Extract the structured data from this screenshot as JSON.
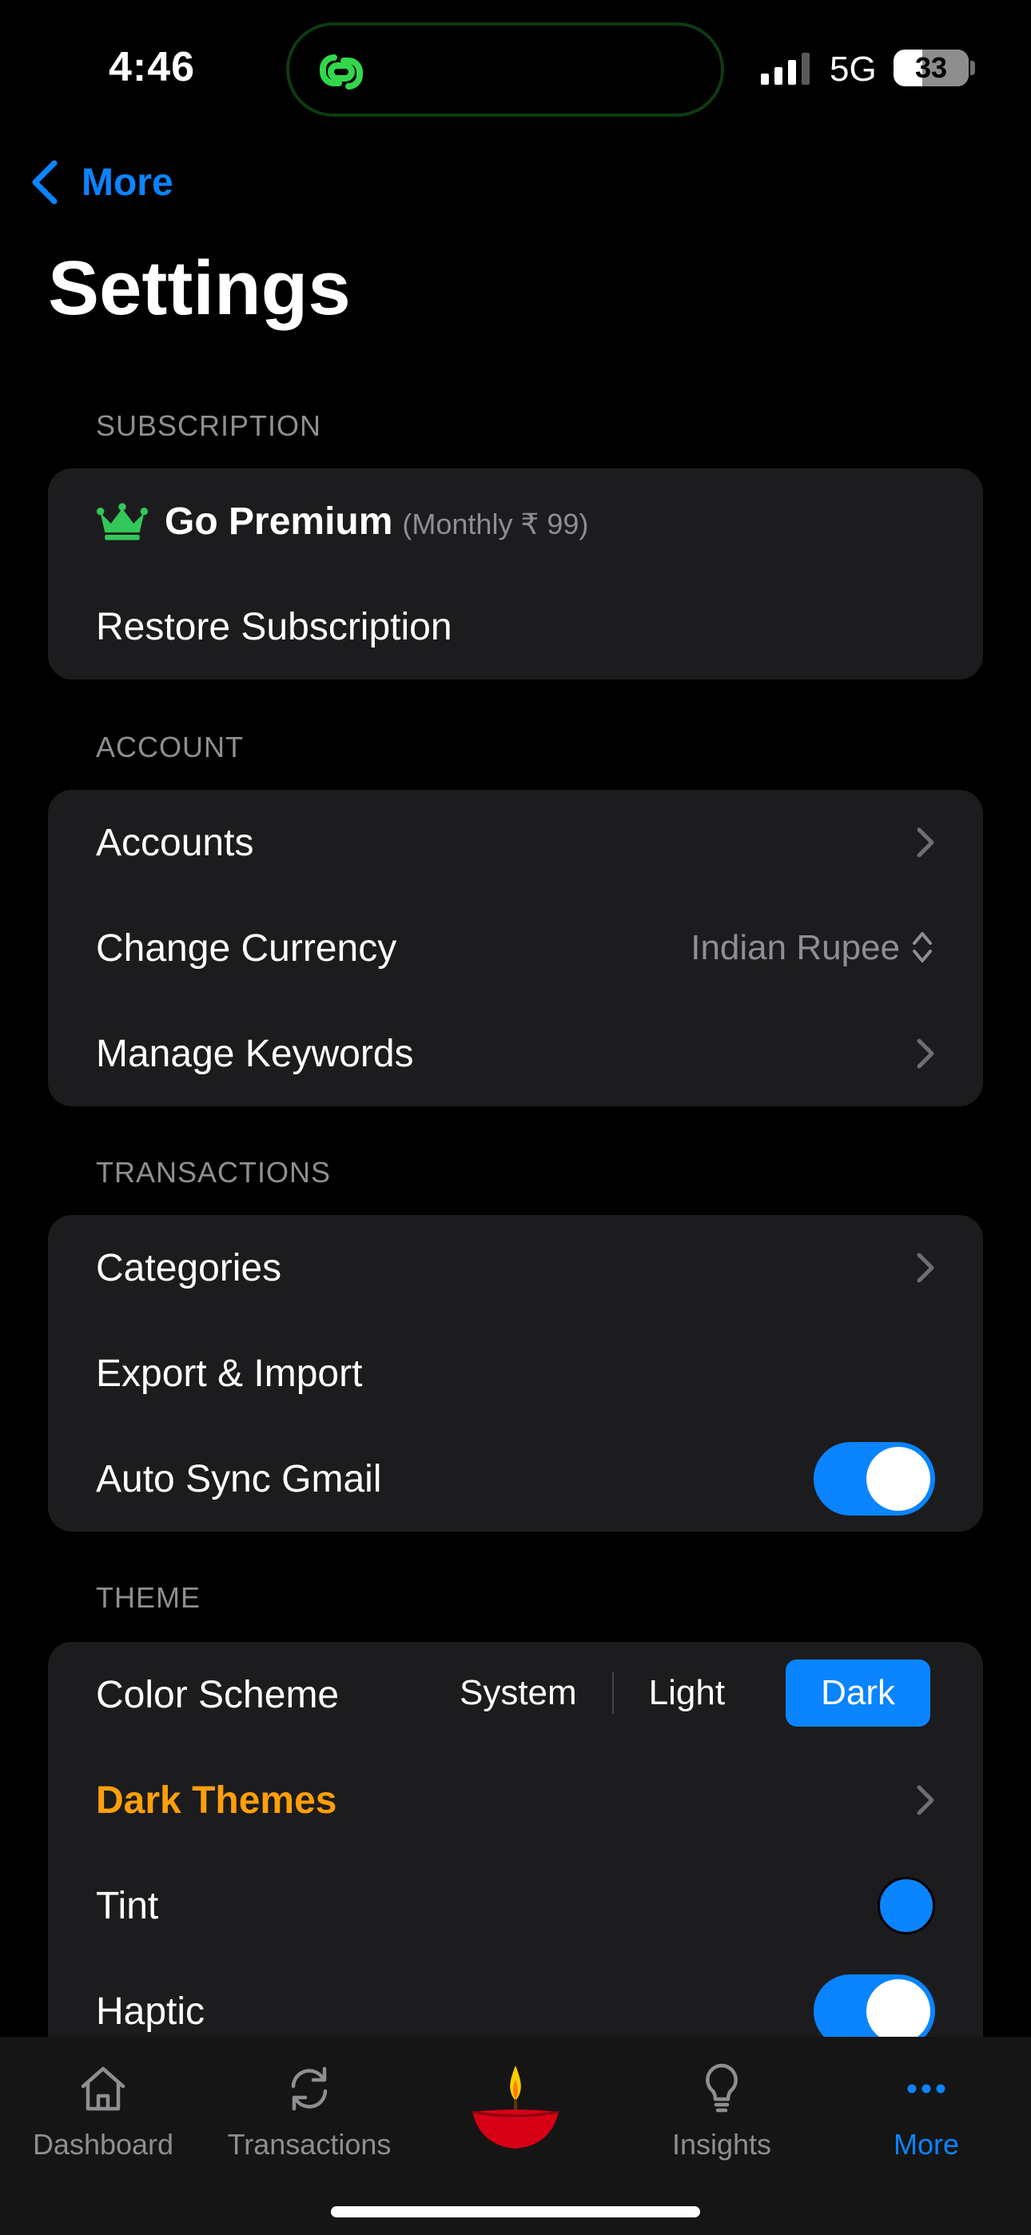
{
  "status_bar": {
    "time": "4:46",
    "network": "5G",
    "battery": "33"
  },
  "nav": {
    "back_label": "More",
    "title": "Settings"
  },
  "sections": {
    "subscription": {
      "header": "SUBSCRIPTION",
      "premium_label": "Go Premium",
      "premium_price": "(Monthly ₹ 99)",
      "restore_label": "Restore Subscription"
    },
    "account": {
      "header": "ACCOUNT",
      "accounts_label": "Accounts",
      "currency_label": "Change Currency",
      "currency_value": "Indian Rupee",
      "keywords_label": "Manage Keywords"
    },
    "transactions": {
      "header": "TRANSACTIONS",
      "categories_label": "Categories",
      "export_label": "Export & Import",
      "autosync_label": "Auto Sync Gmail",
      "autosync_on": true
    },
    "theme": {
      "header": "THEME",
      "color_scheme_label": "Color Scheme",
      "options": [
        "System",
        "Light",
        "Dark"
      ],
      "selected": "Dark",
      "dark_themes_label": "Dark Themes",
      "tint_label": "Tint",
      "haptic_label": "Haptic",
      "haptic_on": true
    }
  },
  "colors": {
    "accent": "#0a84ff",
    "premium_crown": "#34c759",
    "dark_themes": "#ff9f0a",
    "card_bg": "#1c1c1e"
  },
  "tab_bar": {
    "tabs": [
      {
        "label": "Dashboard",
        "icon": "house-icon"
      },
      {
        "label": "Transactions",
        "icon": "sync-icon"
      },
      {
        "label": "",
        "icon": "diya-lamp-icon"
      },
      {
        "label": "Insights",
        "icon": "lightbulb-icon"
      },
      {
        "label": "More",
        "icon": "ellipsis-icon"
      }
    ],
    "active": "More"
  }
}
